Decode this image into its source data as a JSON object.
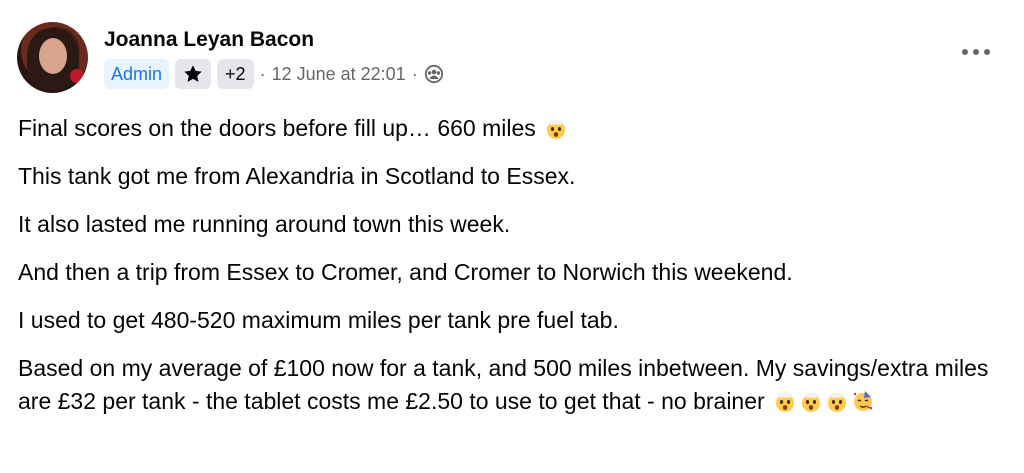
{
  "post": {
    "author": "Joanna Leyan Bacon",
    "badges": {
      "admin": "Admin",
      "extra": "+2"
    },
    "separator": "·",
    "timestamp": "12 June at 22:01",
    "audience_icon": "group-icon",
    "star_icon": "star-icon",
    "more_icon": "more-options-icon",
    "lines": [
      "Final scores on the doors before fill up… 660 miles",
      "This tank got me from Alexandria in Scotland to Essex.",
      "It also lasted me running around town this week.",
      "And then a trip from Essex to Cromer, and Cromer to Norwich this weekend.",
      "I used to get 480-520 maximum miles per tank pre fuel tab.",
      "Based on my average of £100 now for a tank, and 500 miles inbetween. My savings/extra miles are £32 per tank - the tablet costs me £2.50 to use to get that - no brainer"
    ],
    "emoji": {
      "line1": [
        "exploding-head"
      ],
      "last": [
        "exploding-head",
        "exploding-head",
        "exploding-head",
        "partying-face"
      ]
    }
  },
  "colors": {
    "admin_bg": "#e7f3ff",
    "admin_text": "#1b74e4",
    "chip_bg": "#e4e6eb",
    "meta_text": "#65676b"
  }
}
